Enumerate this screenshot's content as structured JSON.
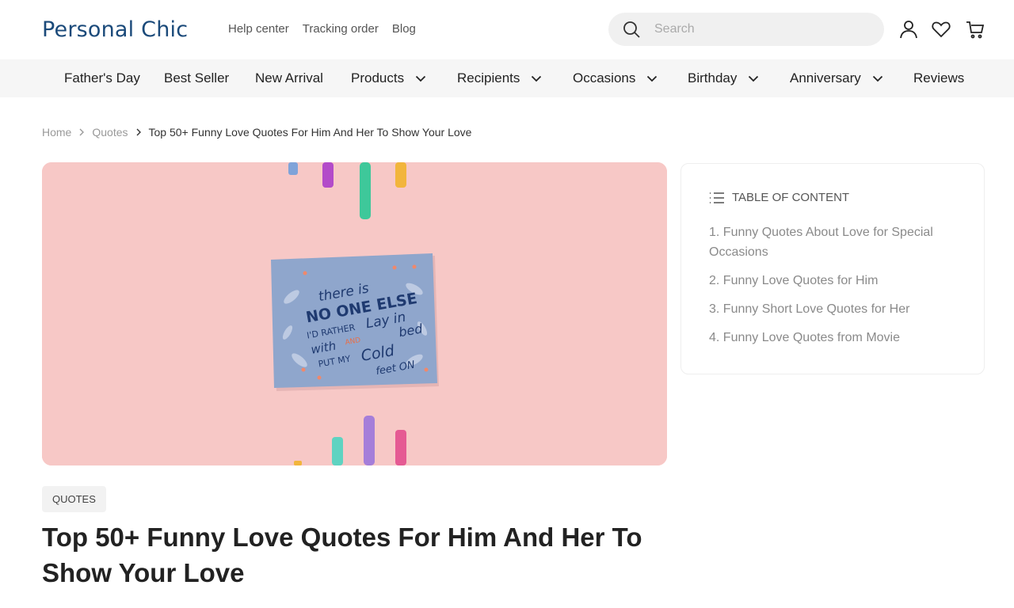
{
  "header": {
    "logo": "Personal Chic",
    "links": [
      "Help center",
      "Tracking order",
      "Blog"
    ],
    "search_placeholder": "Search"
  },
  "nav": {
    "items": [
      {
        "label": "Father's Day",
        "dropdown": false
      },
      {
        "label": "Best Seller",
        "dropdown": false
      },
      {
        "label": "New Arrival",
        "dropdown": false
      },
      {
        "label": "Products",
        "dropdown": true
      },
      {
        "label": "Recipients",
        "dropdown": true
      },
      {
        "label": "Occasions",
        "dropdown": true
      },
      {
        "label": "Birthday",
        "dropdown": true
      },
      {
        "label": "Anniversary",
        "dropdown": true
      },
      {
        "label": "Reviews",
        "dropdown": false
      }
    ]
  },
  "breadcrumb": {
    "home": "Home",
    "section": "Quotes",
    "current": "Top 50+ Funny Love Quotes For Him And Her To Show Your Love"
  },
  "hero": {
    "card_lines": [
      "there is",
      "NO ONE ELSE",
      "I'D RATHER",
      "Lay in",
      "with",
      "bed",
      "AND",
      "PUT MY",
      "Cold",
      "feet ON"
    ]
  },
  "article": {
    "tag": "QUOTES",
    "title": "Top 50+ Funny Love Quotes For Him And Her To Show Your Love"
  },
  "toc": {
    "heading": "TABLE OF CONTENT",
    "items": [
      "1. Funny Quotes About Love for Special Occasions",
      "2. Funny Love Quotes for Him",
      "3. Funny Short Love Quotes for Her",
      "4. Funny Love Quotes from Movie"
    ]
  },
  "colors": {
    "brand": "#1b4a7a",
    "hero_background": "#f7c8c6",
    "card": "#8fa6cc",
    "nav_background": "#f6f6f6"
  }
}
